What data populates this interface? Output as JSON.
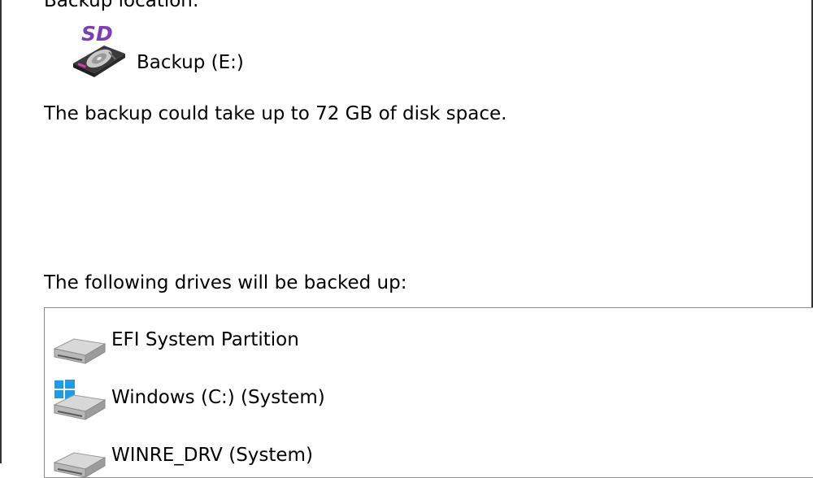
{
  "backup_location": {
    "label": "Backup location:",
    "target_name": "Backup (E:)",
    "icon": "sd-card-drive-icon",
    "icon_text": "SD",
    "icon_text_color": "#7b3fb5"
  },
  "disk_space_text": "The backup could take up to 72 GB of disk space.",
  "drives": {
    "heading": "The following drives will be backed up:",
    "items": [
      {
        "label": "EFI System Partition",
        "icon": "hard-drive-icon",
        "system_badge": false
      },
      {
        "label": "Windows (C:) (System)",
        "icon": "windows-drive-icon",
        "system_badge": true
      },
      {
        "label": "WINRE_DRV (System)",
        "icon": "hard-drive-icon",
        "system_badge": false
      }
    ]
  },
  "colors": {
    "window_border": "#333333",
    "list_border": "#8c8c8c",
    "windows_logo": "#1a9ee8"
  }
}
